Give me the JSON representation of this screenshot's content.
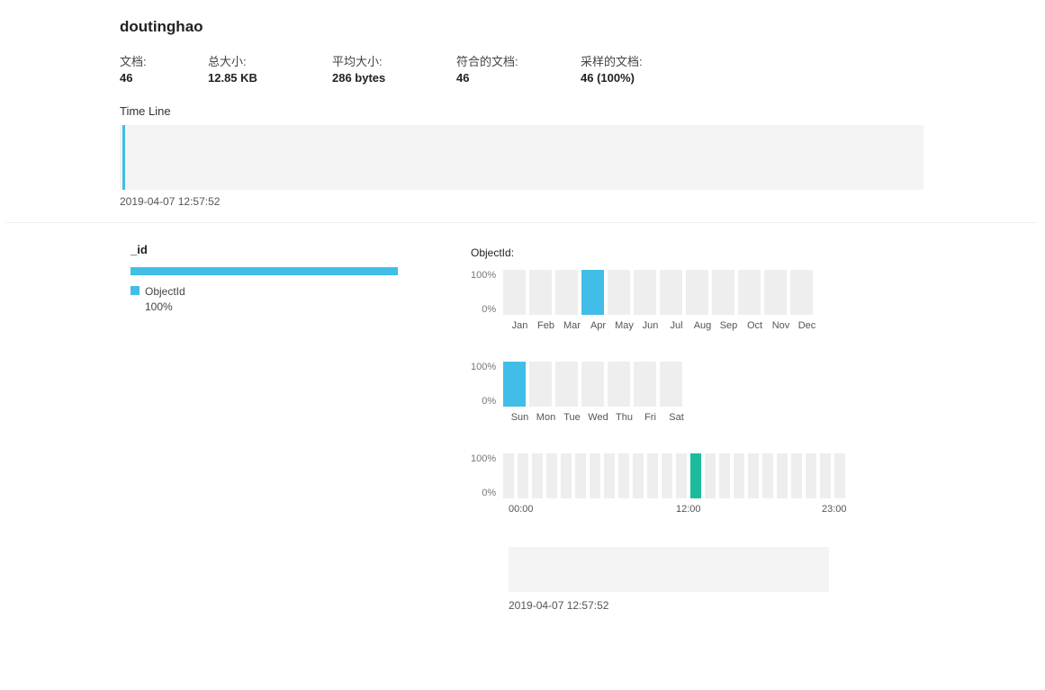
{
  "title": "doutinghao",
  "stats": {
    "docs_label": "文档:",
    "docs_value": "46",
    "total_label": "总大小:",
    "total_value": "12.85 KB",
    "avg_label": "平均大小:",
    "avg_value": "286 bytes",
    "match_label": "符合的文档:",
    "match_value": "46",
    "sampled_label": "采样的文档:",
    "sampled_value": "46 (100%)"
  },
  "timeline": {
    "title": "Time Line",
    "caption": "2019-04-07 12:57:52"
  },
  "field": {
    "name": "_id",
    "legend_type": "ObjectId",
    "legend_pct": "100%",
    "bar_pct": 100
  },
  "rightTitle": "ObjectId:",
  "ylabels": {
    "hi": "100%",
    "lo": "0%"
  },
  "charts": {
    "month": {
      "labels": [
        "Jan",
        "Feb",
        "Mar",
        "Apr",
        "May",
        "Jun",
        "Jul",
        "Aug",
        "Sep",
        "Oct",
        "Nov",
        "Dec"
      ],
      "values": [
        0,
        0,
        0,
        100,
        0,
        0,
        0,
        0,
        0,
        0,
        0,
        0
      ]
    },
    "dow": {
      "labels": [
        "Sun",
        "Mon",
        "Tue",
        "Wed",
        "Thu",
        "Fri",
        "Sat"
      ],
      "values": [
        100,
        0,
        0,
        0,
        0,
        0,
        0
      ]
    },
    "hour": {
      "count": 24,
      "values": [
        0,
        0,
        0,
        0,
        0,
        0,
        0,
        0,
        0,
        0,
        0,
        0,
        0,
        100,
        0,
        0,
        0,
        0,
        0,
        0,
        0,
        0,
        0,
        0
      ],
      "xlabels": {
        "start": "00:00",
        "mid": "12:00",
        "end": "23:00"
      }
    }
  },
  "subTimeline": {
    "caption": "2019-04-07 12:57:52"
  },
  "chart_data": [
    {
      "type": "bar",
      "title": "ObjectId distribution by month",
      "categories": [
        "Jan",
        "Feb",
        "Mar",
        "Apr",
        "May",
        "Jun",
        "Jul",
        "Aug",
        "Sep",
        "Oct",
        "Nov",
        "Dec"
      ],
      "values": [
        0,
        0,
        0,
        100,
        0,
        0,
        0,
        0,
        0,
        0,
        0,
        0
      ],
      "ylabel": "%",
      "ylim": [
        0,
        100
      ]
    },
    {
      "type": "bar",
      "title": "ObjectId distribution by day of week",
      "categories": [
        "Sun",
        "Mon",
        "Tue",
        "Wed",
        "Thu",
        "Fri",
        "Sat"
      ],
      "values": [
        100,
        0,
        0,
        0,
        0,
        0,
        0
      ],
      "ylabel": "%",
      "ylim": [
        0,
        100
      ]
    },
    {
      "type": "bar",
      "title": "ObjectId distribution by hour",
      "categories": [
        "0",
        "1",
        "2",
        "3",
        "4",
        "5",
        "6",
        "7",
        "8",
        "9",
        "10",
        "11",
        "12",
        "13",
        "14",
        "15",
        "16",
        "17",
        "18",
        "19",
        "20",
        "21",
        "22",
        "23"
      ],
      "values": [
        0,
        0,
        0,
        0,
        0,
        0,
        0,
        0,
        0,
        0,
        0,
        0,
        0,
        100,
        0,
        0,
        0,
        0,
        0,
        0,
        0,
        0,
        0,
        0
      ],
      "ylabel": "%",
      "ylim": [
        0,
        100
      ]
    }
  ]
}
